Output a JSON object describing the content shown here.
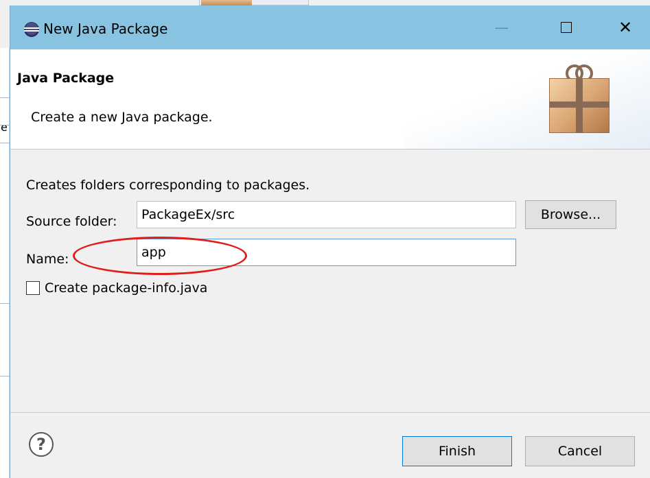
{
  "background": {
    "left_fragment_char": "e"
  },
  "window": {
    "title": "New Java Package",
    "minimize": "—",
    "close": "✕"
  },
  "header": {
    "title": "Java Package",
    "description": "Create a new Java package.",
    "icon": "gift-package-icon"
  },
  "form": {
    "description": "Creates folders corresponding to packages.",
    "source_folder_label": "Source folder:",
    "source_folder_value": "PackageEx/src",
    "browse_label": "Browse...",
    "name_label": "Name:",
    "name_value": "app",
    "create_package_info_label": "Create package-info.java",
    "create_package_info_checked": false
  },
  "footer": {
    "help_symbol": "?",
    "finish_label": "Finish",
    "cancel_label": "Cancel"
  },
  "colors": {
    "titlebar": "#88c4e1",
    "annotation": "#e01e1e",
    "focus": "#0078d7"
  }
}
